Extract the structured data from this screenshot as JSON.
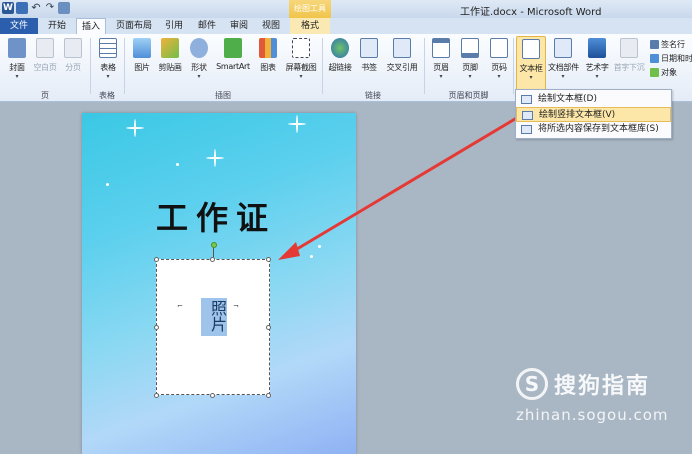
{
  "window": {
    "title": "工作证.docx - Microsoft Word",
    "context_header": "绘图工具"
  },
  "tabs": [
    {
      "label": "文件"
    },
    {
      "label": "开始"
    },
    {
      "label": "插入"
    },
    {
      "label": "页面布局"
    },
    {
      "label": "引用"
    },
    {
      "label": "邮件"
    },
    {
      "label": "审阅"
    },
    {
      "label": "视图"
    },
    {
      "label": "格式"
    }
  ],
  "ribbon": {
    "buttons": {
      "cover": "封面",
      "blank_page": "空白页",
      "page_break": "分页",
      "table": "表格",
      "picture": "图片",
      "clipart": "剪贴画",
      "shapes": "形状",
      "smartart": "SmartArt",
      "chart": "图表",
      "screenshot": "屏幕截图",
      "hyperlink": "超链接",
      "bookmark": "书签",
      "crossref": "交叉引用",
      "header": "页眉",
      "footer": "页脚",
      "page_number": "页码",
      "textbox": "文本框",
      "quickparts": "文档部件",
      "wordart": "艺术字",
      "dropcap": "首字下沉"
    },
    "small": {
      "signature": "签名行",
      "datetime": "日期和时",
      "object": "对象"
    },
    "groups": {
      "pages": "页",
      "tables": "表格",
      "illustrations": "插图",
      "links": "链接",
      "header_footer": "页眉和页脚"
    }
  },
  "textbox_menu": {
    "items": [
      {
        "label": "绘制文本框(D)"
      },
      {
        "label": "绘制竖排文本框(V)"
      },
      {
        "label": "将所选内容保存到文本框库(S)"
      }
    ]
  },
  "document": {
    "heading": "工作证",
    "photo_text": "照片"
  },
  "watermark": {
    "logo": "S",
    "text": "搜狗指南",
    "url": "zhinan.sogou.com"
  },
  "colors": {
    "file_tab": "#2b5fae",
    "highlight": "#fde7a8",
    "arrow": "#e53935",
    "context_header": "#f1c44a"
  },
  "icons": [
    "word-logo-icon",
    "save-icon",
    "undo-icon",
    "redo-icon",
    "print-preview-icon"
  ]
}
